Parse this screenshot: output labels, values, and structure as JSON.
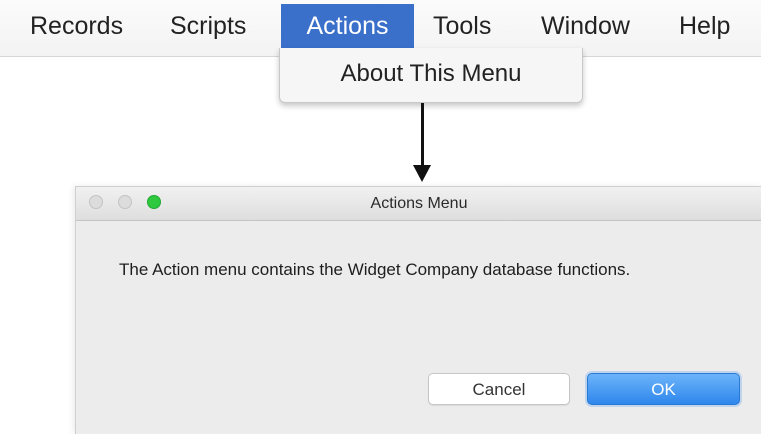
{
  "menubar": {
    "items": [
      {
        "label": "Records",
        "active": false
      },
      {
        "label": "Scripts",
        "active": false
      },
      {
        "label": "Actions",
        "active": true
      },
      {
        "label": "Tools",
        "active": false
      },
      {
        "label": "Window",
        "active": false
      },
      {
        "label": "Help",
        "active": false
      }
    ]
  },
  "dropdown": {
    "items": [
      {
        "label": "About This Menu"
      }
    ]
  },
  "dialog": {
    "title": "Actions Menu",
    "message": "The Action menu contains the Widget Company database functions.",
    "window_controls": [
      "close-icon",
      "minimize-icon",
      "zoom-icon"
    ],
    "buttons": {
      "cancel_label": "Cancel",
      "ok_label": "OK"
    }
  },
  "colors": {
    "menu_highlight": "#3a6fca",
    "ok_button": "#3d8ff0",
    "zoom_button": "#2ec93f"
  }
}
